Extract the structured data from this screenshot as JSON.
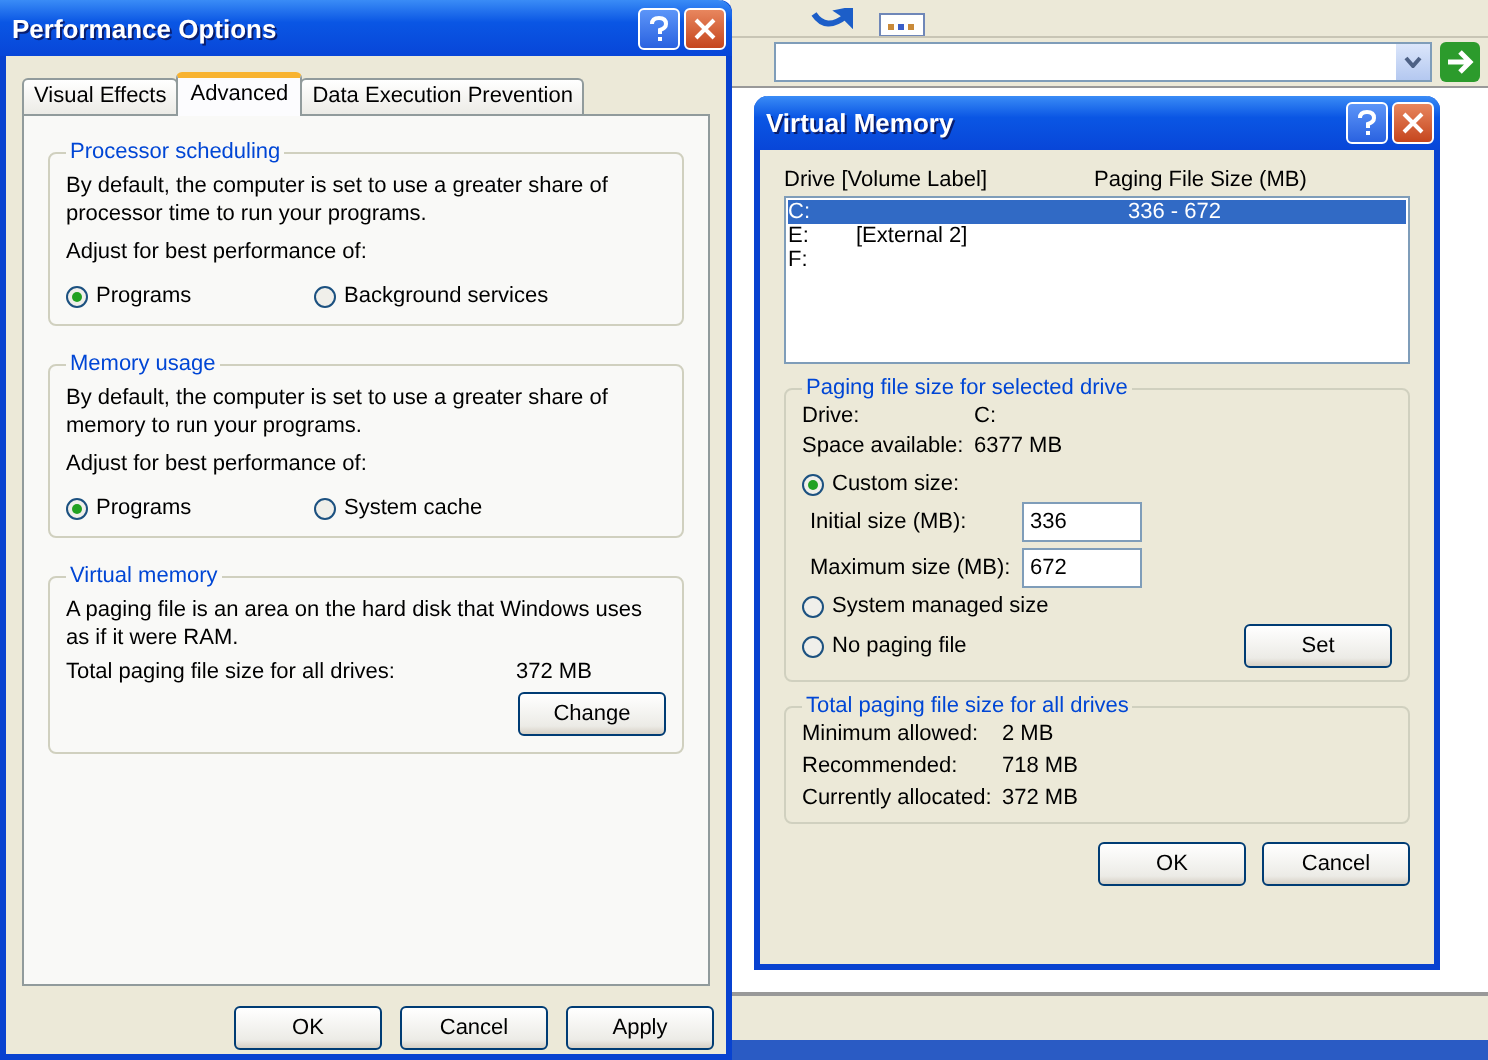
{
  "performance_options": {
    "title": "Performance Options",
    "tabs": [
      {
        "label": "Visual Effects",
        "selected": false
      },
      {
        "label": "Advanced",
        "selected": true
      },
      {
        "label": "Data Execution Prevention",
        "selected": false
      }
    ],
    "groups": [
      {
        "kind": "radio",
        "title": "Processor scheduling",
        "description": "By default, the computer is set to use a greater share of processor time to run your programs.",
        "prompt": "Adjust for best performance of:",
        "options": [
          {
            "label": "Programs",
            "selected": true
          },
          {
            "label": "Background services",
            "selected": false
          }
        ]
      },
      {
        "kind": "radio",
        "title": "Memory usage",
        "description": "By default, the computer is set to use a greater share of memory to run your programs.",
        "prompt": "Adjust for best performance of:",
        "options": [
          {
            "label": "Programs",
            "selected": true
          },
          {
            "label": "System cache",
            "selected": false
          }
        ]
      },
      {
        "kind": "info",
        "title": "Virtual memory",
        "description": "A paging file is an area on the hard disk that Windows uses as if it were RAM.",
        "total_label": "Total paging file size for all drives:",
        "total_value": "372 MB",
        "button": "Change"
      }
    ],
    "buttons": [
      "OK",
      "Cancel",
      "Apply"
    ]
  },
  "virtual_memory": {
    "title": "Virtual Memory",
    "columns": [
      "Drive  [Volume Label]",
      "Paging File Size (MB)"
    ],
    "drives": [
      {
        "drive": "C:",
        "size": "336 - 672",
        "selected": true
      },
      {
        "drive": "E:",
        "label": "[External 2]",
        "selected": false
      },
      {
        "drive": "F:",
        "selected": false
      }
    ],
    "selected_drive": {
      "title": "Paging file size for selected drive",
      "drive_label": "Drive:",
      "drive_value": "C:",
      "space_label": "Space available:",
      "space_value": "6377 MB",
      "options": [
        {
          "label": "Custom size:",
          "selected": true
        },
        {
          "label": "System managed size",
          "selected": false
        },
        {
          "label": "No paging file",
          "selected": false
        }
      ],
      "initial_label": "Initial size (MB):",
      "initial_value": "336",
      "maximum_label": "Maximum size (MB):",
      "maximum_value": "672",
      "set_button": "Set"
    },
    "totals": {
      "title": "Total paging file size for all drives",
      "rows": [
        {
          "label": "Minimum allowed:",
          "value": "2 MB"
        },
        {
          "label": "Recommended:",
          "value": "718 MB"
        },
        {
          "label": "Currently allocated:",
          "value": "372 MB"
        }
      ]
    },
    "buttons": [
      "OK",
      "Cancel"
    ]
  }
}
